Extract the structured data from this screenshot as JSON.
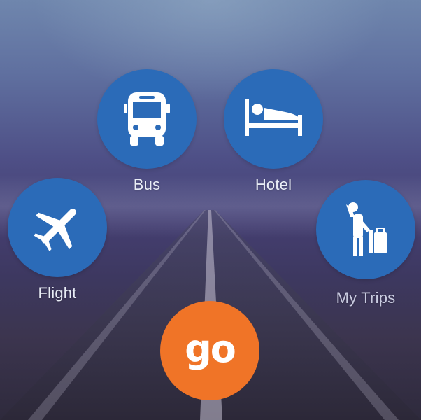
{
  "background": {
    "style": "misty-highway"
  },
  "menu": {
    "bus": {
      "label": "Bus",
      "icon": "bus-icon"
    },
    "hotel": {
      "label": "Hotel",
      "icon": "bed-icon"
    },
    "flight": {
      "label": "Flight",
      "icon": "airplane-icon"
    },
    "trips": {
      "label": "My Trips",
      "icon": "traveler-with-luggage-icon"
    }
  },
  "go_button": {
    "text": "go"
  },
  "colors": {
    "tile_blue": "#2b6bb8",
    "go_orange": "#f07427",
    "label": "#e9edf6"
  }
}
